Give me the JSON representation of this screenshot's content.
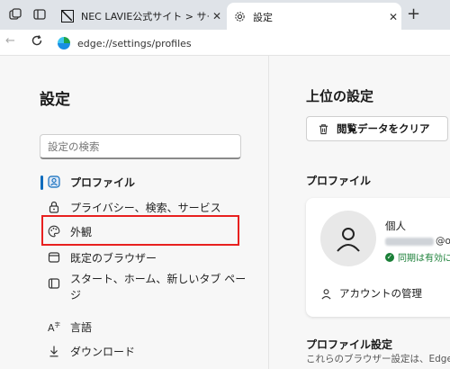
{
  "browser": {
    "tabs": [
      {
        "title": "NEC LAVIE公式サイト > サービス&サ"
      },
      {
        "title": "設定"
      }
    ],
    "new_tab_symbol": "+",
    "url": "edge://settings/profiles"
  },
  "sidebar": {
    "title": "設定",
    "search_placeholder": "設定の検索",
    "items": [
      {
        "label": "プロファイル",
        "icon": "profile-icon",
        "active": true
      },
      {
        "label": "プライバシー、検索、サービス",
        "icon": "lock-icon"
      },
      {
        "label": "外観",
        "icon": "palette-icon",
        "highlighted": true
      },
      {
        "label": "既定のブラウザー",
        "icon": "browser-icon"
      },
      {
        "label": "スタート、ホーム、新しいタブ ページ",
        "icon": "home-icon"
      },
      {
        "label": "言語",
        "icon": "language-icon"
      },
      {
        "label": "ダウンロード",
        "icon": "download-icon"
      }
    ]
  },
  "main": {
    "top_title": "上位の設定",
    "clear_button": "閲覧データをクリア",
    "profile_heading": "プロファイル",
    "profile": {
      "name": "個人",
      "email_suffix": "@o",
      "sync_status": "同期は有効に"
    },
    "account_manage": "アカウントの管理",
    "profile_settings_heading": "プロファイル設定",
    "profile_settings_desc": "これらのブラウザー設定は、Edge"
  },
  "colors": {
    "accent": "#0f6cbd",
    "highlight_box": "#e8201f",
    "sync_green": "#1a7f37"
  }
}
